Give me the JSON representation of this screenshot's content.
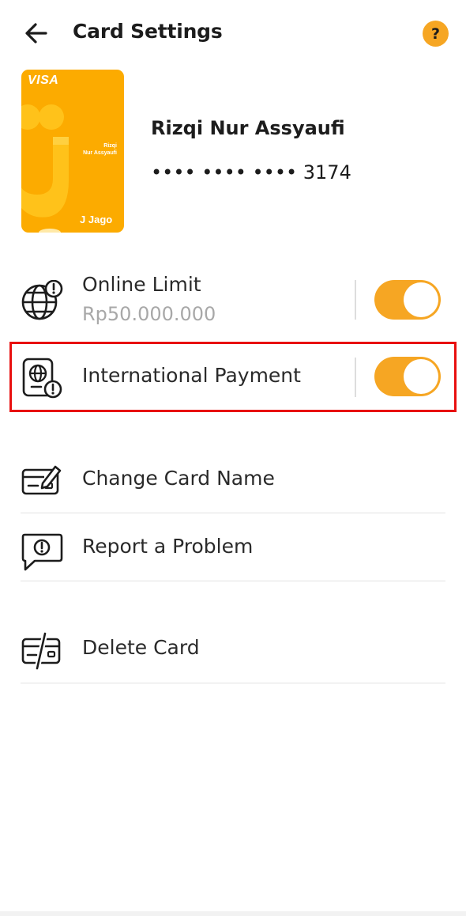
{
  "header": {
    "title": "Card Settings",
    "help_label": "?"
  },
  "card": {
    "network": "VISA",
    "holder_line1": "Rizqi",
    "holder_line2": "Nur Assyaufi",
    "brand": "Jago",
    "brand_mark": "J",
    "owner_name": "Rizqi Nur Assyaufi",
    "number_masked": "•••• •••• •••• 3174"
  },
  "settings": {
    "online_limit": {
      "label": "Online Limit",
      "value": "Rp50.000.000",
      "enabled": true
    },
    "international_payment": {
      "label": "International Payment",
      "enabled": true
    }
  },
  "actions": {
    "change_card_name": "Change Card Name",
    "report_problem": "Report a Problem",
    "delete_card": "Delete Card"
  },
  "colors": {
    "accent": "#f6a623",
    "card": "#fcab00",
    "highlight": "#e8100f"
  },
  "icons": {
    "back": "arrow-left-icon",
    "help": "question-icon",
    "online_limit": "globe-alert-icon",
    "international": "passport-alert-icon",
    "change_name": "card-pencil-icon",
    "report": "chat-alert-icon",
    "delete": "card-slash-icon"
  }
}
